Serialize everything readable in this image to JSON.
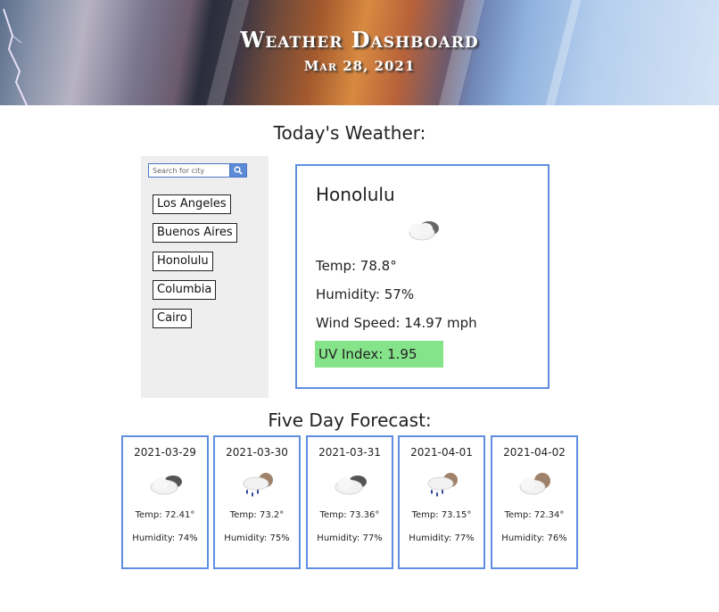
{
  "header": {
    "title": "Weather Dashboard",
    "date": "Mar 28, 2021"
  },
  "today_heading": "Today's Weather:",
  "search": {
    "placeholder": "Search for city",
    "icon": "search-icon"
  },
  "cities": [
    "Los Angeles",
    "Buenos Aires",
    "Honolulu",
    "Columbia",
    "Cairo"
  ],
  "current": {
    "city": "Honolulu",
    "icon": "partly-cloudy-icon",
    "temp": "Temp: 78.8°",
    "humidity": "Humidity: 57%",
    "wind": "Wind Speed: 14.97 mph",
    "uv": "UV Index: 1.95",
    "uv_color": "#85e38a"
  },
  "forecast_heading": "Five Day Forecast:",
  "forecast": [
    {
      "date": "2021-03-29",
      "icon": "cloudy-icon",
      "temp": "Temp: 72.41°",
      "humidity": "Humidity: 74%"
    },
    {
      "date": "2021-03-30",
      "icon": "rain-icon",
      "temp": "Temp: 73.2°",
      "humidity": "Humidity: 75%"
    },
    {
      "date": "2021-03-31",
      "icon": "cloudy-icon",
      "temp": "Temp: 73.36°",
      "humidity": "Humidity: 77%"
    },
    {
      "date": "2021-04-01",
      "icon": "rain-icon",
      "temp": "Temp: 73.15°",
      "humidity": "Humidity: 77%"
    },
    {
      "date": "2021-04-02",
      "icon": "partly-cloudy-icon",
      "temp": "Temp: 72.34°",
      "humidity": "Humidity: 76%"
    }
  ],
  "colors": {
    "accent_border": "#5f8ee0",
    "sidebar_bg": "#eeeeee",
    "search_button": "#5b8ad6"
  }
}
